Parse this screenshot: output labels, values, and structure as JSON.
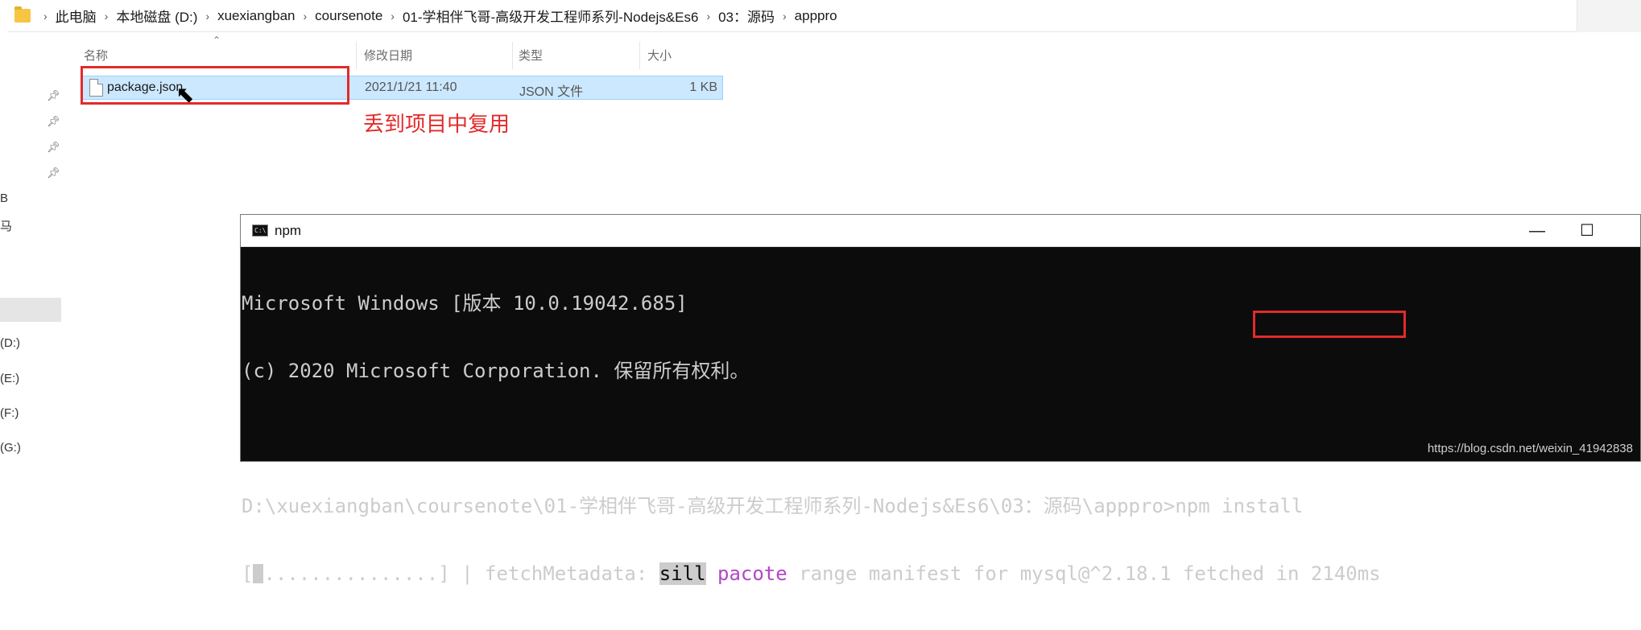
{
  "address_bar": {
    "crumbs": [
      "此电脑",
      "本地磁盘 (D:)",
      "xuexiangban",
      "coursenote",
      "01-学相伴飞哥-高级开发工程师系列-Nodejs&Es6",
      "03：源码",
      "apppro"
    ]
  },
  "left_nav": {
    "cut_labels": [
      "B",
      "马",
      "(D:)",
      "(E:)",
      "(F:)",
      "(G:)"
    ]
  },
  "file_list": {
    "columns": [
      "名称",
      "修改日期",
      "类型",
      "大小"
    ],
    "rows": [
      {
        "name": "package.json",
        "modified": "2021/1/21 11:40",
        "type": "JSON 文件",
        "size": "1 KB"
      }
    ]
  },
  "annotation": {
    "text": "丢到项目中复用",
    "color": "#e32a2a"
  },
  "cmd_window": {
    "title": "npm",
    "icon_text": "C:\\",
    "minimize": "—",
    "maximize": "☐",
    "lines": {
      "l1": "Microsoft Windows [版本 10.0.19042.685]",
      "l2": "(c) 2020 Microsoft Corporation. 保留所有权利。",
      "prompt": "D:\\xuexiangban\\coursenote\\01-学相伴飞哥-高级开发工程师系列-Nodejs&Es6\\03：源码\\apppro>",
      "command": "npm install",
      "progress_open": "[",
      "progress_dots": "...............",
      "progress_close": "] | fetchMetadata: ",
      "level": "sill",
      "module": "pacote",
      "message": " range manifest for mysql@^2.18.1 fetched in 2140ms"
    },
    "colors": {
      "background": "#0c0c0c",
      "text": "#cccccc",
      "pacote": "#b148c6"
    }
  },
  "watermark": "https://blog.csdn.net/weixin_41942838"
}
